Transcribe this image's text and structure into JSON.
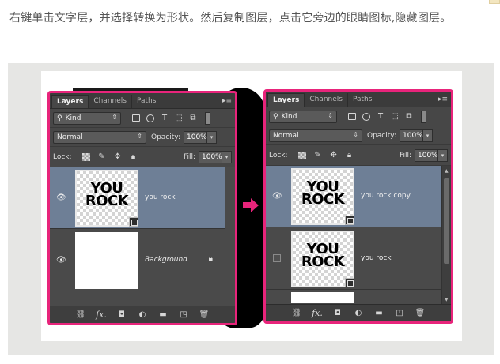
{
  "caption": "右键单击文字层，并选择转换为形状。然后复制图层，点击它旁边的眼睛图标,隐藏图层。",
  "panel": {
    "tabs": [
      "Layers",
      "Channels",
      "Paths"
    ],
    "filter_kind": "Kind",
    "blend_mode": "Normal",
    "opacity_label": "Opacity:",
    "opacity_value": "100%",
    "lock_label": "Lock:",
    "fill_label": "Fill:",
    "fill_value": "100%"
  },
  "thumb_text": {
    "line1": "YOU",
    "line2": "ROCK"
  },
  "left_panel": {
    "layers": [
      {
        "name": "you rock",
        "selected": true,
        "visible": true
      },
      {
        "name": "Background",
        "selected": false,
        "visible": true,
        "locked": true
      }
    ]
  },
  "right_panel": {
    "layers": [
      {
        "name": "you rock copy",
        "selected": true,
        "visible": true
      },
      {
        "name": "you rock",
        "selected": false,
        "visible": false
      }
    ]
  },
  "icons": {
    "search": "search-icon",
    "visibility": "eye-icon",
    "lock": "lock-icon",
    "link": "link-icon",
    "fx": "fx-icon",
    "mask": "mask-icon",
    "adjustment": "adjustment-icon",
    "folder": "folder-icon",
    "new_layer": "new-layer-icon",
    "trash": "trash-icon"
  },
  "colors": {
    "highlight_border": "#e8247b",
    "selected_layer": "#6e7f96",
    "panel_bg": "#474747",
    "arrow": "#e8247b"
  }
}
